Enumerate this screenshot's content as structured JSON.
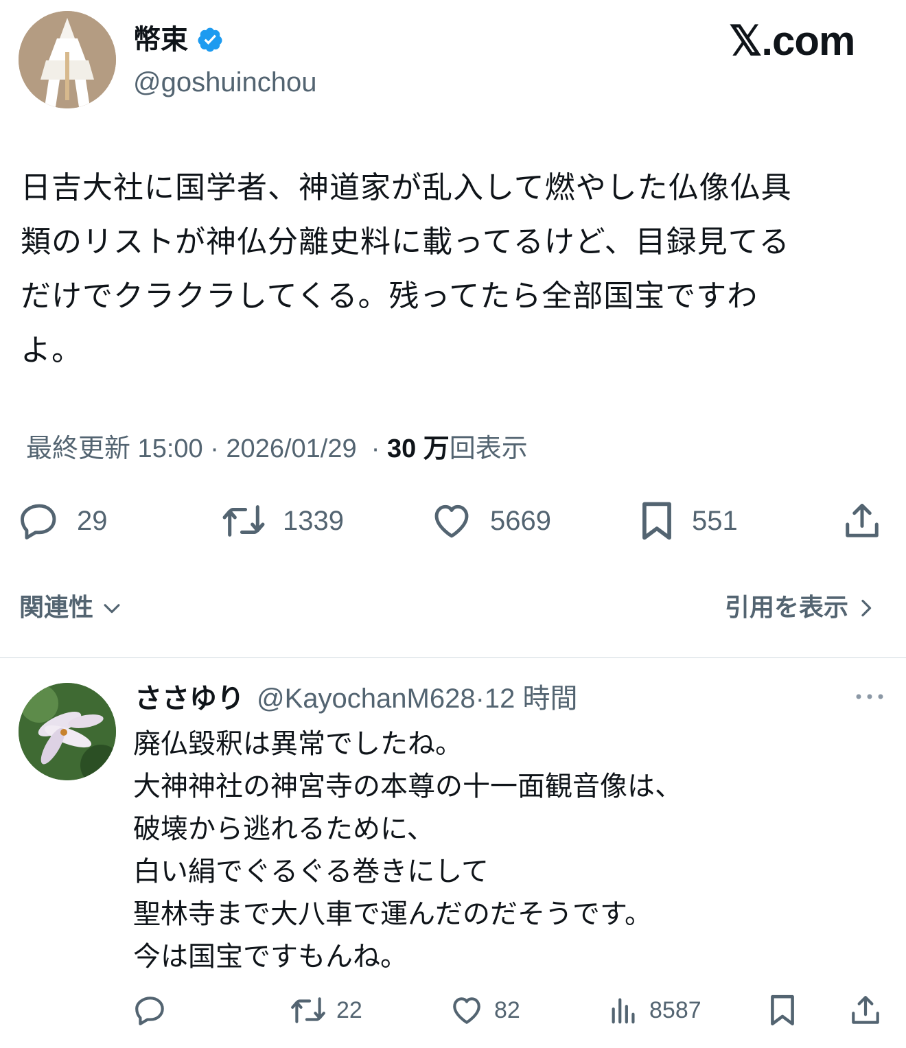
{
  "tweet": {
    "author_name": "幣束",
    "author_handle": "@goshuinchou",
    "brand": "𝕏.com",
    "lines": [
      "日吉大社に国学者、神道家が乱入して燃やした仏像仏具",
      "類のリストが神仏分離史料に載ってるけど、目録見てる",
      "だけでクラクラしてくる。残ってたら全部国宝ですわ",
      "よ。"
    ],
    "meta_prefix": "最終更新 15:00 · 2026/01/29",
    "meta_sep": "·",
    "views_count": "30 万",
    "views_label": "回表示",
    "actions": {
      "replies": "29",
      "reposts": "1339",
      "likes": "5669",
      "bookmarks": "551"
    },
    "relevance_label": "関連性",
    "quotes_label": "引用を表示"
  },
  "reply": {
    "name": "ささゆり",
    "handle": "@KayochanM628",
    "dot": "·",
    "time": "12 時間",
    "lines": [
      "廃仏毀釈は異常でしたね。",
      "大神神社の神宮寺の本尊の十一面観音像は、",
      "破壊から逃れるために、",
      "白い絹でぐるぐる巻きにして",
      "聖林寺まで大八車で運んだのだそうです。",
      "今は国宝ですもんね。"
    ],
    "actions": {
      "reposts": "22",
      "likes": "82",
      "views": "8587"
    }
  },
  "colors": {
    "text": "#0f1419",
    "secondary": "#536471",
    "verified": "#1d9bf0",
    "divider": "#cfd9de"
  },
  "icons": [
    "verified-badge-icon",
    "reply-icon",
    "repost-icon",
    "like-icon",
    "bookmark-icon",
    "share-icon",
    "chevron-down-icon",
    "chevron-right-icon",
    "more-icon",
    "views-icon"
  ]
}
